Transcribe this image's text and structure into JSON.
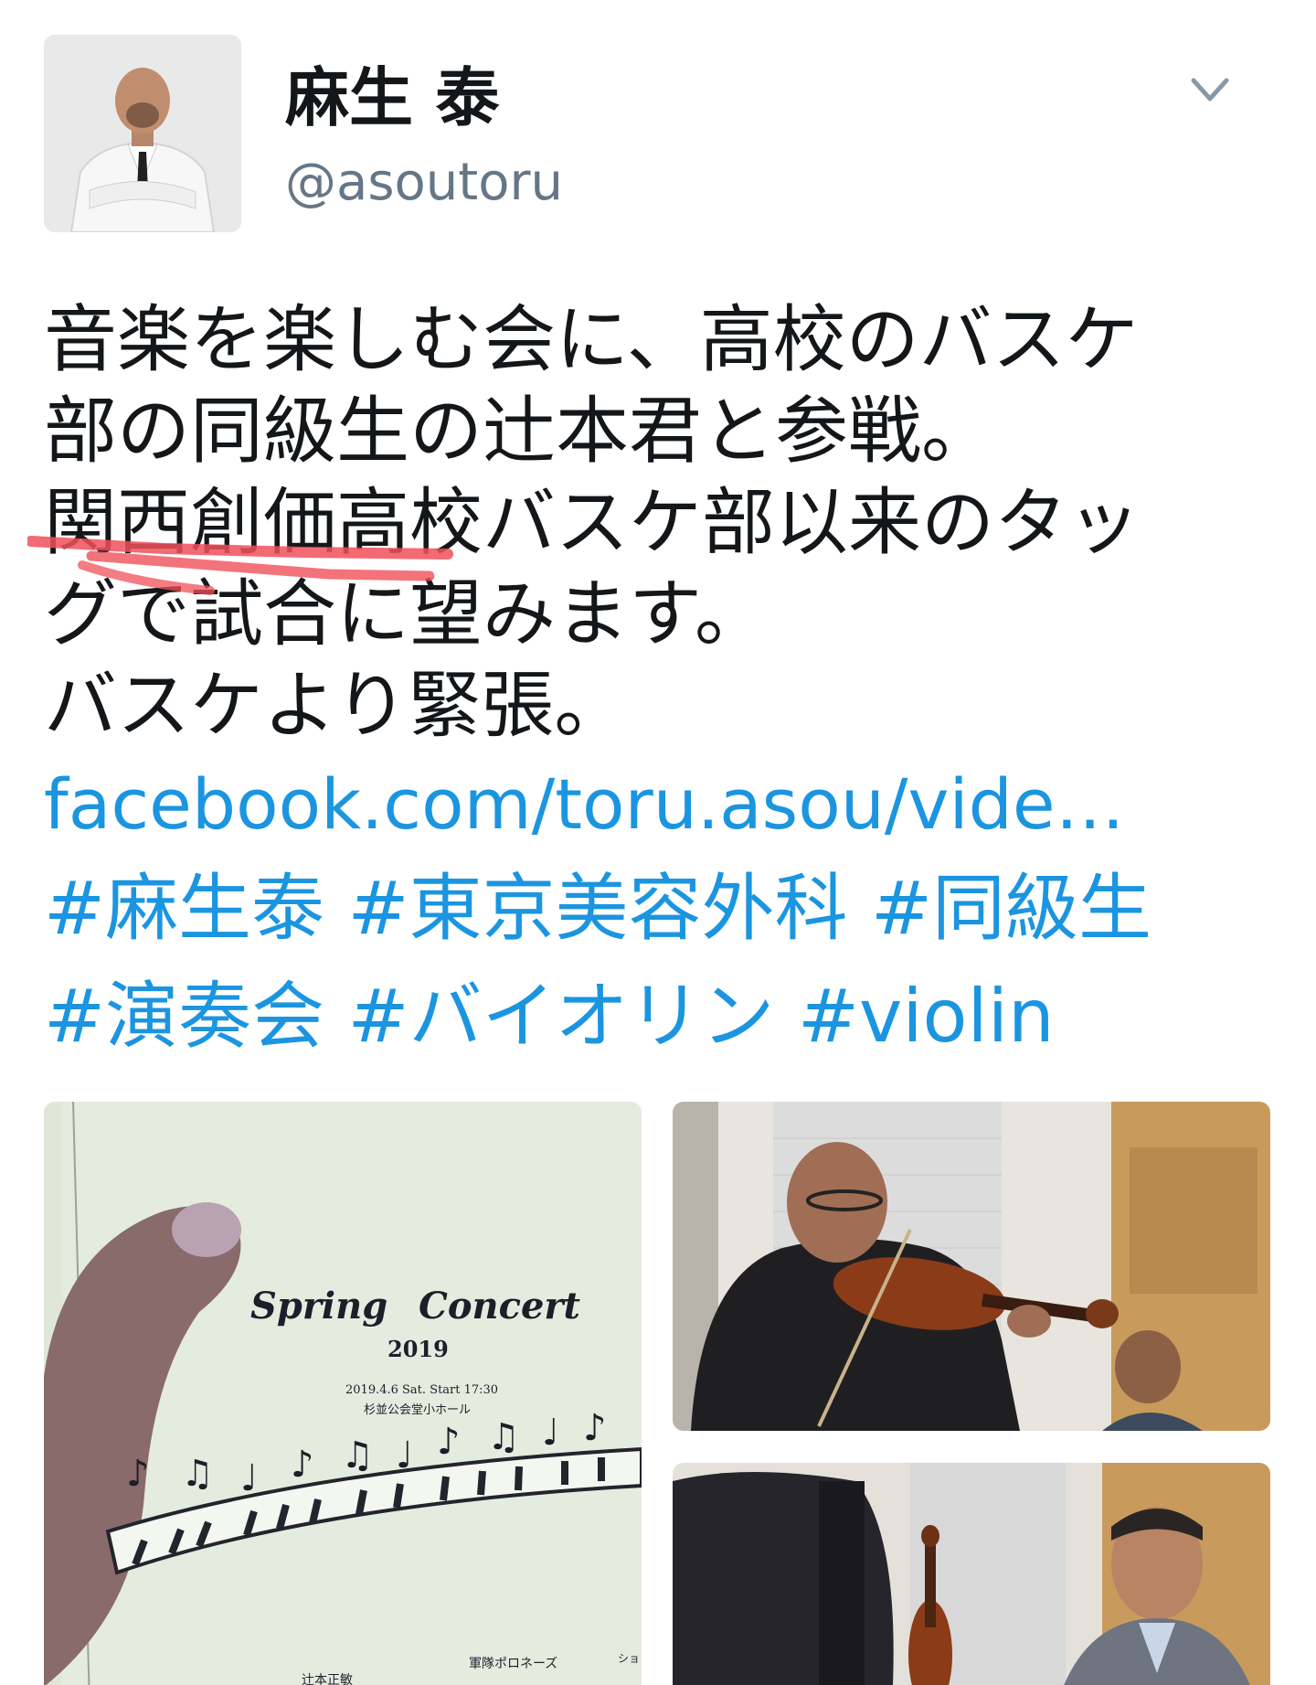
{
  "header": {
    "display_name": "麻生 泰",
    "handle": "@asoutoru"
  },
  "tweet": {
    "lines": [
      "音楽を楽しむ会に、高校のバスケ",
      "部の同級生の辻本君と参戦。",
      "関西創価高校バスケ部以来のタッ",
      "グで試合に望みます。",
      "バスケより緊張。"
    ],
    "link": "facebook.com/toru.asou/vide…",
    "hashtags": [
      "#麻生泰",
      "#東京美容外科",
      "#同級生",
      "#演奏会",
      "#バイオリン",
      "#violin"
    ]
  },
  "media": {
    "flyer": {
      "title_1": "Spring",
      "title_2": "Concert",
      "year": "2019",
      "date": "2019.4.6 Sat. Start 17:30",
      "venue": "杉並公会堂小ホール",
      "program_1": "軍隊ポロネーズ",
      "program_2": "辻本正敏",
      "program_3": "ショ"
    }
  },
  "icons": {
    "menu": "chevron-down-icon"
  },
  "colors": {
    "link": "#1b95e0",
    "handle": "#657786",
    "text": "#14171a",
    "highlight": "#f0505a"
  }
}
